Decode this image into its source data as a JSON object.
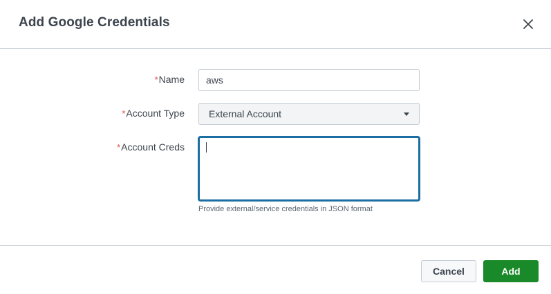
{
  "dialog": {
    "title": "Add Google Credentials",
    "close_icon": "close-icon"
  },
  "form": {
    "required_marker": "*",
    "name": {
      "label": "Name",
      "value": "aws"
    },
    "account_type": {
      "label": "Account Type",
      "selected": "External Account",
      "dropdown_icon": "caret-down-icon"
    },
    "account_creds": {
      "label": "Account Creds",
      "value": "",
      "help": "Provide external/service credentials in JSON format"
    }
  },
  "footer": {
    "cancel_label": "Cancel",
    "add_label": "Add"
  },
  "colors": {
    "required": "#dc4e41",
    "focus_border": "#1a6ea1",
    "primary_button": "#1a8929"
  }
}
